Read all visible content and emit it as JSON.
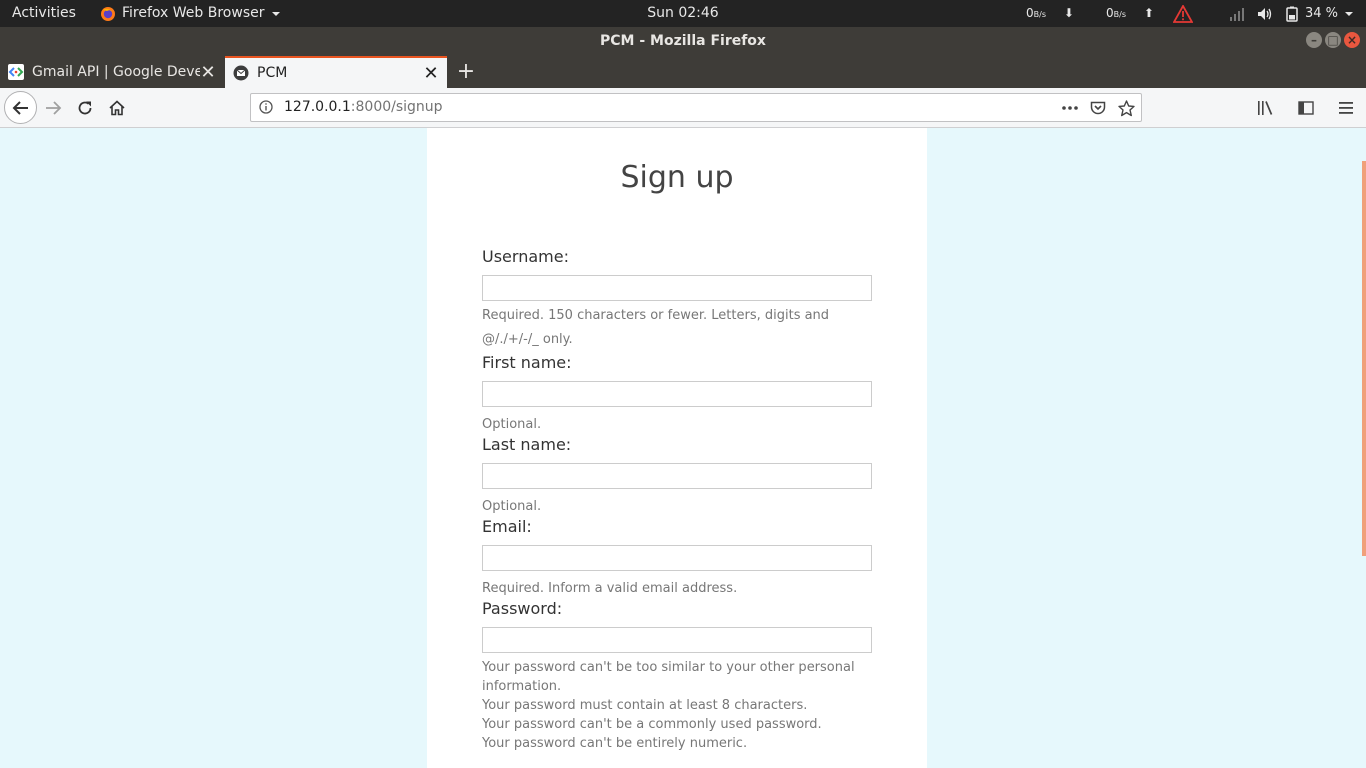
{
  "topbar": {
    "activities": "Activities",
    "app_menu": "Firefox Web Browser",
    "clock": "Sun 02:46",
    "net_down": "0",
    "net_down_unit": "B/s",
    "net_up": "0",
    "net_up_unit": "B/s",
    "battery": "34 %"
  },
  "window": {
    "title": "PCM - Mozilla Firefox"
  },
  "tabs": [
    {
      "title": "Gmail API  |  Google Deve",
      "icon": "google-developers-icon",
      "active": false
    },
    {
      "title": "PCM",
      "icon": "mail-icon",
      "active": true
    }
  ],
  "url": {
    "host": "127.0.0.1",
    "path": ":8000/signup"
  },
  "page": {
    "title": "Sign up",
    "fields": {
      "username": {
        "label": "Username:",
        "value": "",
        "help": "Required. 150 characters or fewer. Letters, digits and @/./+/-/_ only."
      },
      "first_name": {
        "label": "First name:",
        "value": "",
        "help": "Optional."
      },
      "last_name": {
        "label": "Last name:",
        "value": "",
        "help": "Optional."
      },
      "email": {
        "label": "Email:",
        "value": "",
        "help": "Required. Inform a valid email address."
      },
      "password": {
        "label": "Password:",
        "value": "",
        "help": [
          "Your password can't be too similar to your other personal information.",
          "Your password must contain at least 8 characters.",
          "Your password can't be a commonly used password.",
          "Your password can't be entirely numeric."
        ]
      }
    }
  },
  "colors": {
    "page_background": "#e6f8fc",
    "card_background": "#ffffff",
    "active_tab_accent": "#e95420",
    "warning_icon": "#e53935"
  }
}
